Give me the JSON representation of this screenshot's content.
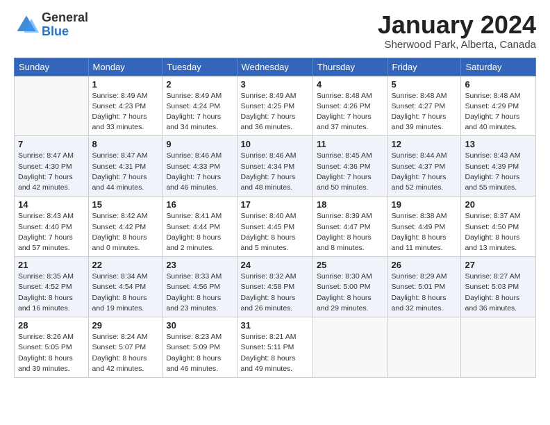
{
  "logo": {
    "general": "General",
    "blue": "Blue"
  },
  "title": "January 2024",
  "subtitle": "Sherwood Park, Alberta, Canada",
  "days_of_week": [
    "Sunday",
    "Monday",
    "Tuesday",
    "Wednesday",
    "Thursday",
    "Friday",
    "Saturday"
  ],
  "weeks": [
    [
      {
        "day": "",
        "sunrise": "",
        "sunset": "",
        "daylight": ""
      },
      {
        "day": "1",
        "sunrise": "Sunrise: 8:49 AM",
        "sunset": "Sunset: 4:23 PM",
        "daylight": "Daylight: 7 hours and 33 minutes."
      },
      {
        "day": "2",
        "sunrise": "Sunrise: 8:49 AM",
        "sunset": "Sunset: 4:24 PM",
        "daylight": "Daylight: 7 hours and 34 minutes."
      },
      {
        "day": "3",
        "sunrise": "Sunrise: 8:49 AM",
        "sunset": "Sunset: 4:25 PM",
        "daylight": "Daylight: 7 hours and 36 minutes."
      },
      {
        "day": "4",
        "sunrise": "Sunrise: 8:48 AM",
        "sunset": "Sunset: 4:26 PM",
        "daylight": "Daylight: 7 hours and 37 minutes."
      },
      {
        "day": "5",
        "sunrise": "Sunrise: 8:48 AM",
        "sunset": "Sunset: 4:27 PM",
        "daylight": "Daylight: 7 hours and 39 minutes."
      },
      {
        "day": "6",
        "sunrise": "Sunrise: 8:48 AM",
        "sunset": "Sunset: 4:29 PM",
        "daylight": "Daylight: 7 hours and 40 minutes."
      }
    ],
    [
      {
        "day": "7",
        "sunrise": "Sunrise: 8:47 AM",
        "sunset": "Sunset: 4:30 PM",
        "daylight": "Daylight: 7 hours and 42 minutes."
      },
      {
        "day": "8",
        "sunrise": "Sunrise: 8:47 AM",
        "sunset": "Sunset: 4:31 PM",
        "daylight": "Daylight: 7 hours and 44 minutes."
      },
      {
        "day": "9",
        "sunrise": "Sunrise: 8:46 AM",
        "sunset": "Sunset: 4:33 PM",
        "daylight": "Daylight: 7 hours and 46 minutes."
      },
      {
        "day": "10",
        "sunrise": "Sunrise: 8:46 AM",
        "sunset": "Sunset: 4:34 PM",
        "daylight": "Daylight: 7 hours and 48 minutes."
      },
      {
        "day": "11",
        "sunrise": "Sunrise: 8:45 AM",
        "sunset": "Sunset: 4:36 PM",
        "daylight": "Daylight: 7 hours and 50 minutes."
      },
      {
        "day": "12",
        "sunrise": "Sunrise: 8:44 AM",
        "sunset": "Sunset: 4:37 PM",
        "daylight": "Daylight: 7 hours and 52 minutes."
      },
      {
        "day": "13",
        "sunrise": "Sunrise: 8:43 AM",
        "sunset": "Sunset: 4:39 PM",
        "daylight": "Daylight: 7 hours and 55 minutes."
      }
    ],
    [
      {
        "day": "14",
        "sunrise": "Sunrise: 8:43 AM",
        "sunset": "Sunset: 4:40 PM",
        "daylight": "Daylight: 7 hours and 57 minutes."
      },
      {
        "day": "15",
        "sunrise": "Sunrise: 8:42 AM",
        "sunset": "Sunset: 4:42 PM",
        "daylight": "Daylight: 8 hours and 0 minutes."
      },
      {
        "day": "16",
        "sunrise": "Sunrise: 8:41 AM",
        "sunset": "Sunset: 4:44 PM",
        "daylight": "Daylight: 8 hours and 2 minutes."
      },
      {
        "day": "17",
        "sunrise": "Sunrise: 8:40 AM",
        "sunset": "Sunset: 4:45 PM",
        "daylight": "Daylight: 8 hours and 5 minutes."
      },
      {
        "day": "18",
        "sunrise": "Sunrise: 8:39 AM",
        "sunset": "Sunset: 4:47 PM",
        "daylight": "Daylight: 8 hours and 8 minutes."
      },
      {
        "day": "19",
        "sunrise": "Sunrise: 8:38 AM",
        "sunset": "Sunset: 4:49 PM",
        "daylight": "Daylight: 8 hours and 11 minutes."
      },
      {
        "day": "20",
        "sunrise": "Sunrise: 8:37 AM",
        "sunset": "Sunset: 4:50 PM",
        "daylight": "Daylight: 8 hours and 13 minutes."
      }
    ],
    [
      {
        "day": "21",
        "sunrise": "Sunrise: 8:35 AM",
        "sunset": "Sunset: 4:52 PM",
        "daylight": "Daylight: 8 hours and 16 minutes."
      },
      {
        "day": "22",
        "sunrise": "Sunrise: 8:34 AM",
        "sunset": "Sunset: 4:54 PM",
        "daylight": "Daylight: 8 hours and 19 minutes."
      },
      {
        "day": "23",
        "sunrise": "Sunrise: 8:33 AM",
        "sunset": "Sunset: 4:56 PM",
        "daylight": "Daylight: 8 hours and 23 minutes."
      },
      {
        "day": "24",
        "sunrise": "Sunrise: 8:32 AM",
        "sunset": "Sunset: 4:58 PM",
        "daylight": "Daylight: 8 hours and 26 minutes."
      },
      {
        "day": "25",
        "sunrise": "Sunrise: 8:30 AM",
        "sunset": "Sunset: 5:00 PM",
        "daylight": "Daylight: 8 hours and 29 minutes."
      },
      {
        "day": "26",
        "sunrise": "Sunrise: 8:29 AM",
        "sunset": "Sunset: 5:01 PM",
        "daylight": "Daylight: 8 hours and 32 minutes."
      },
      {
        "day": "27",
        "sunrise": "Sunrise: 8:27 AM",
        "sunset": "Sunset: 5:03 PM",
        "daylight": "Daylight: 8 hours and 36 minutes."
      }
    ],
    [
      {
        "day": "28",
        "sunrise": "Sunrise: 8:26 AM",
        "sunset": "Sunset: 5:05 PM",
        "daylight": "Daylight: 8 hours and 39 minutes."
      },
      {
        "day": "29",
        "sunrise": "Sunrise: 8:24 AM",
        "sunset": "Sunset: 5:07 PM",
        "daylight": "Daylight: 8 hours and 42 minutes."
      },
      {
        "day": "30",
        "sunrise": "Sunrise: 8:23 AM",
        "sunset": "Sunset: 5:09 PM",
        "daylight": "Daylight: 8 hours and 46 minutes."
      },
      {
        "day": "31",
        "sunrise": "Sunrise: 8:21 AM",
        "sunset": "Sunset: 5:11 PM",
        "daylight": "Daylight: 8 hours and 49 minutes."
      },
      {
        "day": "",
        "sunrise": "",
        "sunset": "",
        "daylight": ""
      },
      {
        "day": "",
        "sunrise": "",
        "sunset": "",
        "daylight": ""
      },
      {
        "day": "",
        "sunrise": "",
        "sunset": "",
        "daylight": ""
      }
    ]
  ]
}
